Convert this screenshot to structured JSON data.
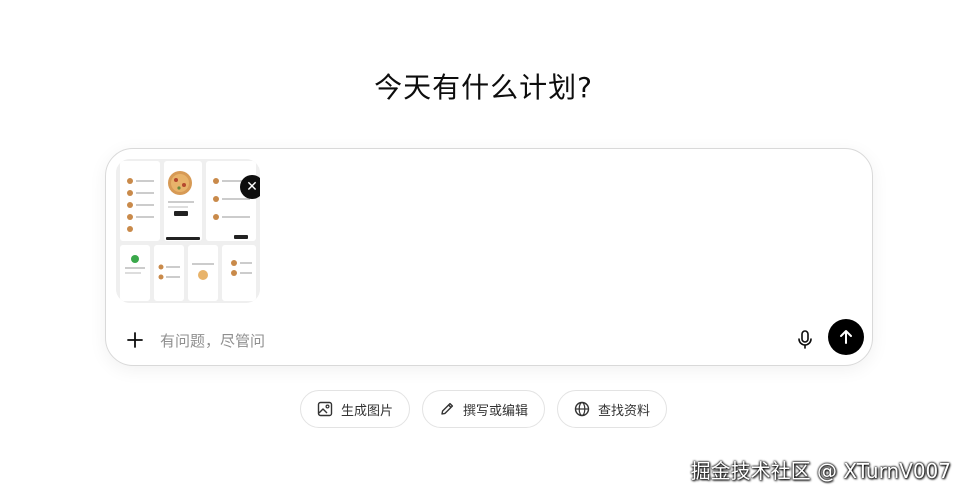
{
  "heading": "今天有什么计划?",
  "composer": {
    "attachment": {
      "name": "ui-mockups-thumbnail",
      "remove_icon": "close-icon"
    },
    "plus_icon": "plus-icon",
    "input_value": "",
    "input_placeholder": "有问题，尽管问",
    "mic_icon": "microphone-icon",
    "send_icon": "arrow-up-icon"
  },
  "suggestions": [
    {
      "label": "生成图片",
      "icon": "image-icon"
    },
    {
      "label": "撰写或编辑",
      "icon": "pencil-icon"
    },
    {
      "label": "查找资料",
      "icon": "globe-icon"
    }
  ],
  "watermark": "掘金技术社区 @ XTurnV007",
  "colors": {
    "background": "#ffffff",
    "send_button": "#000000",
    "border": "#d9d9d9",
    "placeholder": "#8f8f8f"
  }
}
